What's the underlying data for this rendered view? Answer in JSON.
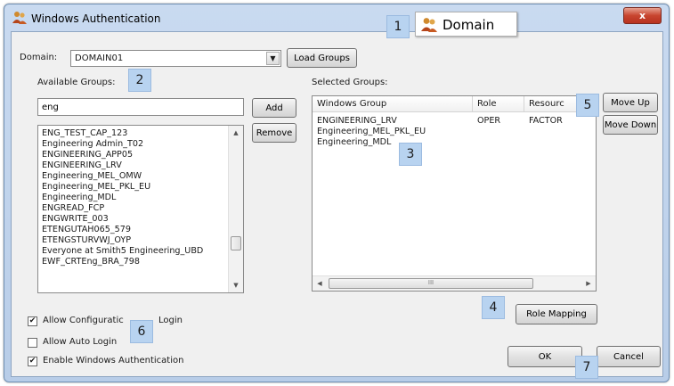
{
  "window": {
    "title": "Windows Authentication",
    "close_label": "x"
  },
  "domain": {
    "label": "Domain:",
    "value": "DOMAIN01",
    "load_button": "Load Groups"
  },
  "available": {
    "label": "Available Groups:",
    "filter_value": "eng",
    "items": [
      "ENG_TEST_CAP_123",
      "Engineering Admin_T02",
      "ENGINEERING_APP05",
      "ENGINEERING_LRV",
      "Engineering_MEL_OMW",
      "Engineering_MEL_PKL_EU",
      "Engineering_MDL",
      "ENGREAD_FCP",
      "ENGWRITE_003",
      "ETENGUTAH065_579",
      "ETENGSTURVWJ_OYP",
      "Everyone at Smith5 Engineering_UBD",
      "EWF_CRTEng_BRA_798"
    ]
  },
  "actions": {
    "add": "Add",
    "remove": "Remove",
    "move_up": "Move Up",
    "move_down": "Move Down",
    "role_mapping": "Role Mapping",
    "ok": "OK",
    "cancel": "Cancel"
  },
  "selected": {
    "label": "Selected Groups:",
    "columns": [
      "Windows Group",
      "Role",
      "Resourc"
    ],
    "rows": [
      {
        "group": "ENGINEERING_LRV",
        "role": "OPER",
        "resource": "FACTOR"
      },
      {
        "group": "Engineering_MEL_PKL_EU",
        "role": "",
        "resource": ""
      },
      {
        "group": "Engineering_MDL",
        "role": "",
        "resource": ""
      }
    ],
    "scroll_grip": "III"
  },
  "options": {
    "allow_configuration_login": {
      "label": "Allow Configuratic",
      "label_tail": "Login",
      "checked": true
    },
    "allow_auto_login": {
      "label": "Allow Auto Login",
      "checked": false
    },
    "enable_windows_auth": {
      "label": "Enable Windows Authentication",
      "checked": true
    }
  },
  "callouts": {
    "domain_text": "Domain",
    "numbers": [
      "1",
      "2",
      "3",
      "4",
      "5",
      "6",
      "7"
    ]
  },
  "glyphs": {
    "check": "✔",
    "down": "▼",
    "up": "▲",
    "left": "◀",
    "right": "▶"
  },
  "colors": {
    "title_bar": "#c9daf0",
    "close_button": "#c8452f",
    "badge": "#b8d3f0",
    "client_background": "#f0f0f0"
  }
}
